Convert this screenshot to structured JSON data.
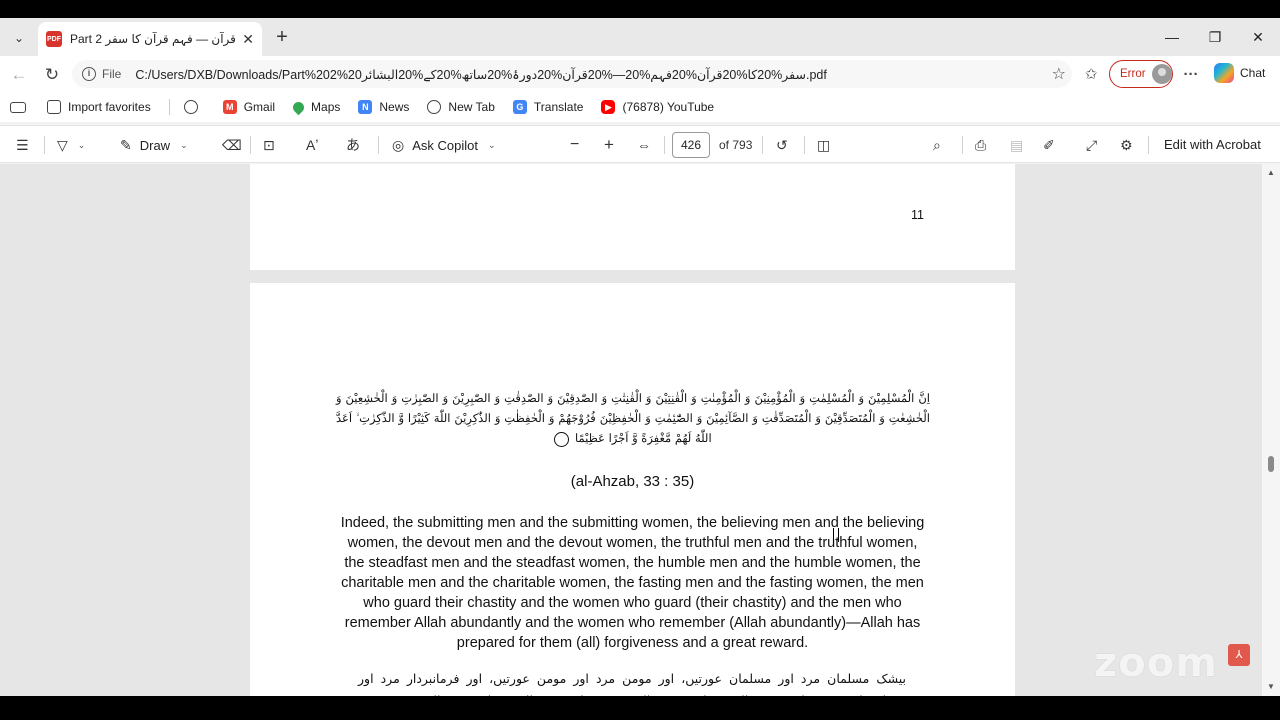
{
  "tab": {
    "title": "Part 2 دورۂ قرآن — فہمِ قرآن کا سفر",
    "favicon_label": "PDF",
    "new_tab_symbol": "+",
    "close_symbol": "✕",
    "dropdown_symbol": "⌄"
  },
  "window_controls": {
    "minimize": "—",
    "restore": "❐",
    "close": "✕"
  },
  "address": {
    "scheme_label": "File",
    "url": "C:/Users/DXB/Downloads/Part%202%20سفر%20کا%20قرآن%20فہم%20—%20قرآن%20دورۂ%20ساتھ%20کے%20البشائر.pdf",
    "error_label": "Error",
    "chat_label": "Chat"
  },
  "favorites": [
    {
      "label": "Import favorites",
      "icon": "folder-icon"
    },
    {
      "label": "",
      "icon": "globe-icon"
    },
    {
      "label": "Gmail",
      "icon": "gmail-icon"
    },
    {
      "label": "Maps",
      "icon": "maps-icon"
    },
    {
      "label": "News",
      "icon": "news-icon"
    },
    {
      "label": "New Tab",
      "icon": "globe-icon"
    },
    {
      "label": "Translate",
      "icon": "translate-icon"
    },
    {
      "label": "(76878) YouTube",
      "icon": "youtube-icon"
    }
  ],
  "pdf_toolbar": {
    "draw_label": "Draw",
    "copilot_label": "Ask Copilot",
    "current_page": "426",
    "total_pages": "of 793",
    "edit_label": "Edit with Acrobat"
  },
  "document": {
    "page_number": "11",
    "arabic_text": "اِنَّ الْمُسْلِمِيْنَ وَ الْمُسْلِمٰتِ وَ الْمُؤْمِنِيْنَ وَ الْمُؤْمِنٰتِ وَ الْقٰنِتِيْنَ وَ الْقٰنِتٰتِ وَ الصّٰدِقِيْنَ وَ الصّٰدِقٰتِ وَ الصّٰبِرِيْنَ وَ الصّٰبِرٰتِ وَ الْخٰشِعِيْنَ وَ الْخٰشِعٰتِ وَ الْمُتَصَدِّقِيْنَ وَ الْمُتَصَدِّقٰتِ وَ الصَّآئِمِيْنَ وَ الصّٰٓئِمٰتِ وَ الْحٰفِظِيْنَ فُرُوْجَهُمْ وَ الْحٰفِظٰتِ وَ الذّٰكِرِيْنَ اللّٰهَ كَثِيْرًا وَّ الذّٰكِرٰتِ ۙ اَعَدَّ اللّٰهُ لَهُمْ مَّغْفِرَةً وَّ اَجْرًا عَظِيْمًا",
    "reference": "(al-Ahzab, 33 : 35)",
    "translation": "Indeed, the submitting men and the submitting women, the believing men and the believing women, the devout men and the devout women, the truthful men and the truthful women, the steadfast men and the steadfast women, the humble men and the humble women, the charitable men and the charitable women, the fasting men and the fasting women, the men who guard their chastity and the women who guard (their chastity) and the men who remember Allah abundantly and the women who remember (Allah abundantly)—Allah has prepared for them (all) forgiveness and a great reward.",
    "urdu_text": "بیشک مسلمان مرد اور مسلمان عورتیں، اور مومن مرد اور مومن عورتیں، اور فرمانبردار مرد اور فرمانبردار عورتیں، اور صدق والے مرد اور صدق والی عورتیں، اور صبر والے مرد اور صبر والی عورتیں"
  },
  "overlay": {
    "zoom_watermark": "zoom"
  }
}
